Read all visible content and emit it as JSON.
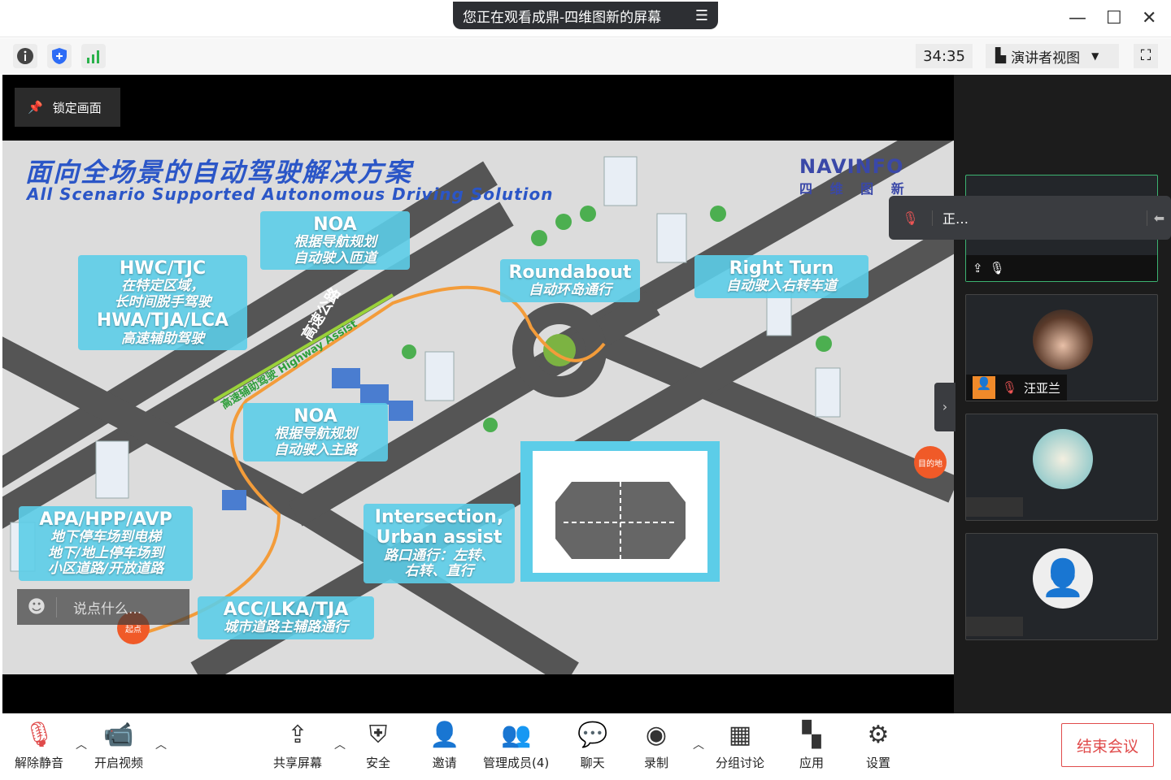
{
  "window": {
    "share_banner": "您正在观看成鼎-四维图新的屏幕",
    "minimize": "—",
    "maximize": "☐",
    "close": "✕"
  },
  "infobar": {
    "timer": "34:35",
    "view_label": "演讲者视图"
  },
  "stage": {
    "lock_label": "锁定画面",
    "chat_placeholder": "说点什么..."
  },
  "slide": {
    "title_cn": "面向全场景的自动驾驶解决方案",
    "title_en": "All Scenario Supported Autonomous Driving Solution",
    "logo_en": "NAVINFO",
    "logo_cn": "四 维 图 新",
    "labels": [
      {
        "h": "NOA",
        "s": [
          "根据导航规划",
          "自动驶入匝道"
        ]
      },
      {
        "h": "HWC/TJC",
        "s": [
          "在特定区域，",
          "长时间脱手驾驶"
        ],
        "h2": "HWA/TJA/LCA",
        "s2": "高速辅助驾驶"
      },
      {
        "h": "Roundabout",
        "s": [
          "自动环岛通行"
        ]
      },
      {
        "h": "Right Turn",
        "s": [
          "自动驶入右转车道"
        ]
      },
      {
        "h": "NOA",
        "s": [
          "根据导航规划",
          "自动驶入主路"
        ]
      },
      {
        "h": "APA/HPP/AVP",
        "s": [
          "地下停车场到电梯",
          "地下/地上停车场到",
          "小区道路/开放道路"
        ]
      },
      {
        "h": "Intersection,",
        "h2": "Urban assist",
        "s": [
          "路口通行：左转、",
          "右转、直行"
        ]
      },
      {
        "h": "ACC/LKA/TJA",
        "s": [
          "城市道路主辅路通行"
        ]
      }
    ],
    "road_highway": "高速公路",
    "road_assist": "高速辅助驾驶 Highway Assist",
    "start": "起点",
    "destination": "目的地"
  },
  "participants": [
    {
      "name": "",
      "speaking": true
    },
    {
      "name": "汪亚兰",
      "muted": true
    },
    {
      "name": ""
    },
    {
      "name": ""
    }
  ],
  "toast": {
    "text": "正…"
  },
  "toolbar": {
    "items": [
      "解除静音",
      "开启视频",
      "共享屏幕",
      "安全",
      "邀请",
      "管理成员(4)",
      "聊天",
      "录制",
      "分组讨论",
      "应用",
      "设置"
    ],
    "end": "结束会议"
  },
  "colors": {
    "accent": "#5ccde8",
    "end": "#e04b4b",
    "title": "#2b56c7"
  }
}
